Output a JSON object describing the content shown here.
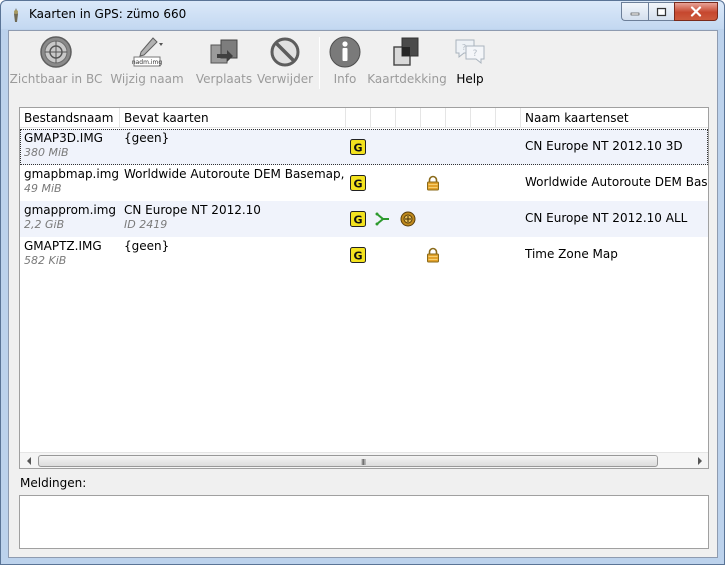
{
  "window": {
    "title": "Kaarten in GPS: zümo 660"
  },
  "toolbar": {
    "buttons": [
      {
        "label": "Zichtbaar in BC",
        "icon": "compass-icon",
        "enabled": false
      },
      {
        "label": "Wijzig naam",
        "icon": "rename-pencil-icon",
        "enabled": false,
        "badge": "nadm.img"
      },
      {
        "label": "Verplaats",
        "icon": "move-icon",
        "enabled": false
      },
      {
        "label": "Verwijder",
        "icon": "delete-icon",
        "enabled": false
      },
      {
        "label": "Info",
        "icon": "info-icon",
        "enabled": false
      },
      {
        "label": "Kaartdekking",
        "icon": "coverage-icon",
        "enabled": false
      },
      {
        "label": "Help",
        "icon": "help-icon",
        "enabled": true
      }
    ]
  },
  "table": {
    "columns": [
      "Bestandsnaam",
      "Bevat kaarten",
      "Naam kaartenset"
    ],
    "rows": [
      {
        "file": "GMAP3D.IMG",
        "size": "380 MiB",
        "maps": "{geen}",
        "maps_sub": "",
        "set": "CN Europe NT 2012.10 3D",
        "icons": [
          "garmin-g-icon"
        ],
        "selected": true
      },
      {
        "file": "gmapbmap.img",
        "size": "49 MiB",
        "maps": "Worldwide Autoroute DEM Basemap,NR",
        "maps_sub": "",
        "set": "Worldwide Autoroute DEM Basemap",
        "icons": [
          "garmin-g-icon",
          "lock-icon"
        ],
        "selected": false
      },
      {
        "file": "gmapprom.img",
        "size": "2,2 GiB",
        "maps": "CN Europe NT 2012.10",
        "maps_sub": "ID 2419",
        "set": "CN Europe NT 2012.10 ALL",
        "icons": [
          "garmin-g-icon",
          "routing-icon",
          "junction-icon"
        ],
        "selected": false
      },
      {
        "file": "GMAPTZ.IMG",
        "size": "582 KiB",
        "maps": "{geen}",
        "maps_sub": "",
        "set": "Time Zone Map",
        "icons": [
          "garmin-g-icon",
          "lock-icon"
        ],
        "selected": false
      }
    ]
  },
  "messages": {
    "label": "Meldingen:"
  },
  "colors": {
    "title_bar": "#c3d8f1",
    "close_button": "#c6472e",
    "garmin_badge": "#f3e21e",
    "lock": "#e3a22a"
  }
}
